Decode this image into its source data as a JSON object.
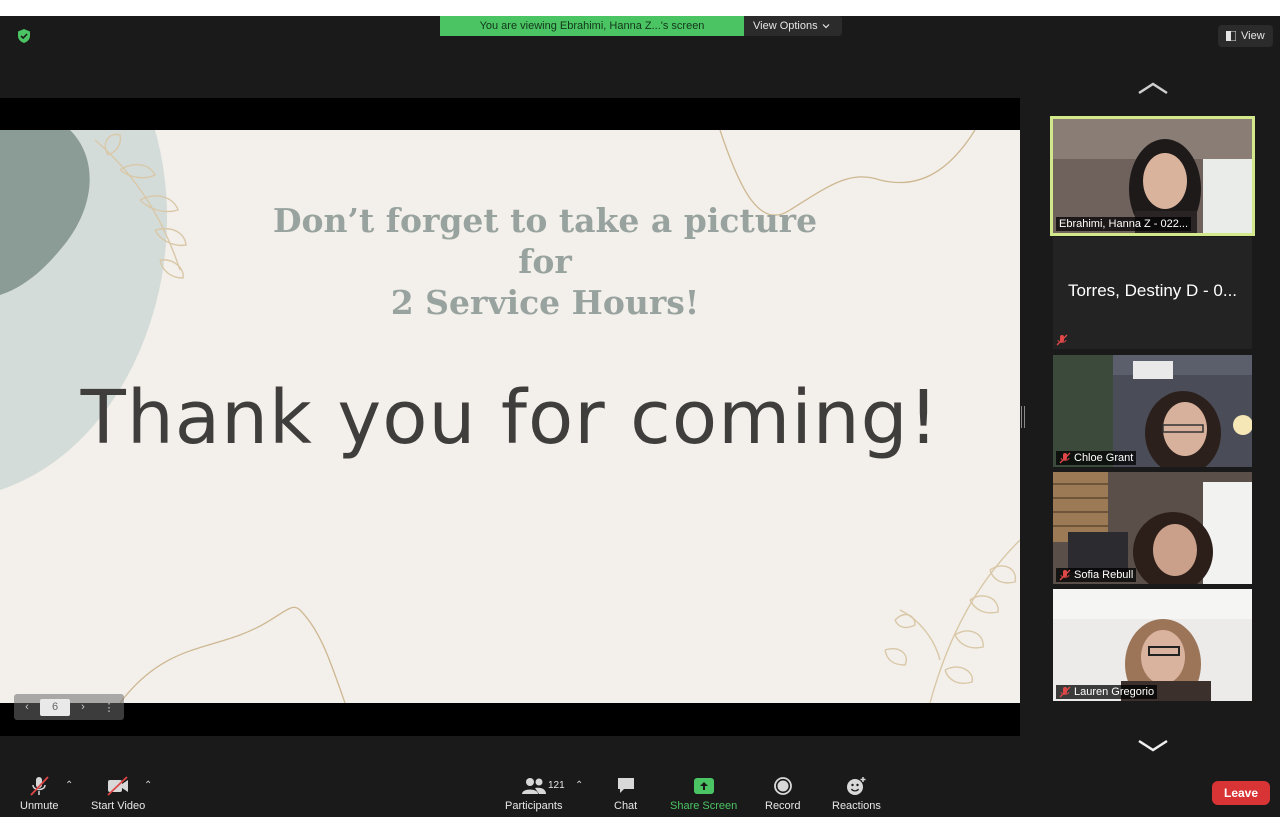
{
  "banner": {
    "viewing_text": "You are viewing Ebrahimi, Hanna Z...'s screen",
    "view_options": "View Options"
  },
  "header": {
    "view_label": "View"
  },
  "slide": {
    "title_line1": "Don’t forget to take a picture for",
    "title_line2": "2 Service Hours!",
    "main_text": "Thank you for coming!",
    "page_number": "6"
  },
  "participants_panel": [
    {
      "name": "Ebrahimi, Hanna Z - 022...",
      "active_speaker": true,
      "video": true,
      "muted": false
    },
    {
      "name": "Torres, Destiny D - 0...",
      "video": false,
      "muted": true
    },
    {
      "name": "Chloe Grant",
      "video": true,
      "muted": true
    },
    {
      "name": "Sofia Rebull",
      "video": true,
      "muted": true
    },
    {
      "name": "Lauren Gregorio",
      "video": true,
      "muted": true
    }
  ],
  "toolbar": {
    "unmute": "Unmute",
    "start_video": "Start Video",
    "participants": "Participants",
    "participant_count": "121",
    "chat": "Chat",
    "share_screen": "Share Screen",
    "record": "Record",
    "reactions": "Reactions",
    "leave": "Leave"
  },
  "colors": {
    "share_green": "#4bc463",
    "leave_red": "#d93435",
    "active_outline": "#d3e88b",
    "muted_red": "#e04848"
  },
  "icons": [
    "shield-icon",
    "view-icon",
    "chevron-up-icon",
    "chevron-down-icon",
    "microphone-muted-icon",
    "video-off-icon",
    "participants-icon",
    "chat-icon",
    "share-screen-icon",
    "record-icon",
    "reactions-icon"
  ]
}
